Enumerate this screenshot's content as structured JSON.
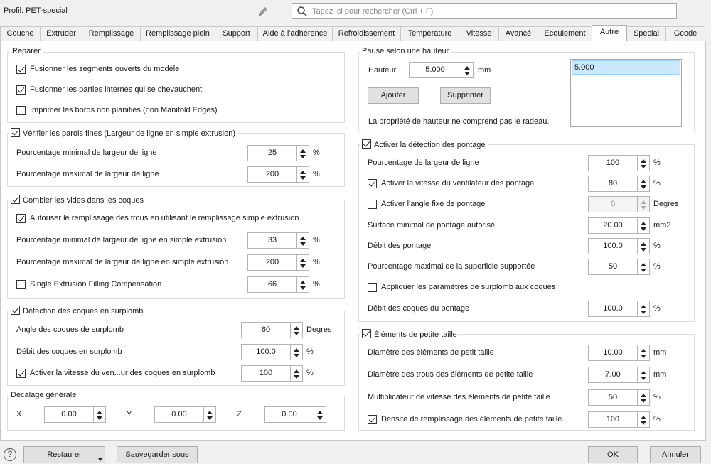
{
  "header": {
    "profile": "Profil: PET-special",
    "search_placeholder": "Tapez ici pour rechercher (Ctrl + F)"
  },
  "tabs": [
    "Couche",
    "Extruder",
    "Remplissage",
    "Remplissage plein",
    "Support",
    "Aide à l'adhérence",
    "Refroidissement",
    "Temperature",
    "Vitesse",
    "Avancé",
    "Ecoulement",
    "Autre",
    "Special",
    "Gcode"
  ],
  "active_tab": "Autre",
  "left": {
    "reparer": {
      "title": "Reparer",
      "items": [
        {
          "label": "Fusionner les segments ouverts du modèle",
          "checked": true
        },
        {
          "label": "Fusionner les parties internes qui se chevauchent",
          "checked": true
        },
        {
          "label": "Imprimer les bords non planifiés (non Manifold Edges)",
          "checked": false
        }
      ]
    },
    "parois": {
      "title": "Vérifier les parois fines (Largeur de ligne en simple extrusion)",
      "checked": true,
      "rows": [
        {
          "label": "Pourcentage minimal de largeur de ligne",
          "value": "25",
          "unit": "%"
        },
        {
          "label": "Pourcentage maximal de largeur de ligne",
          "value": "200",
          "unit": "%"
        }
      ]
    },
    "vides": {
      "title": "Combler les vides dans les coques",
      "checked": true,
      "autoriser": "Autoriser le remplissage des trous en utilisant le remplissage simple extrusion",
      "rows": [
        {
          "label": "Pourcentage minimal de largeur de ligne en simple extrusion",
          "value": "33",
          "unit": "%"
        },
        {
          "label": "Pourcentage maximal de largeur de ligne en simple extrusion",
          "value": "200",
          "unit": "%"
        },
        {
          "label": "Single Extrusion Filling Compensation",
          "value": "66",
          "unit": "%"
        }
      ]
    },
    "surplomb": {
      "title": "Détection des coques en surplomb",
      "checked": true,
      "rows": [
        {
          "label": "Angle des coques de surplomb",
          "value": "60",
          "unit": "Degres"
        },
        {
          "label": "Débit des coques en surplomb",
          "value": "100.0",
          "unit": "%"
        },
        {
          "label": "Activer la vitesse du ven...ur des coques en surplomb",
          "value": "100",
          "unit": "%"
        }
      ]
    },
    "decalage": {
      "title": "Décalage générale",
      "x_label": "X",
      "x": "0.00",
      "y_label": "Y",
      "y": "0.00",
      "z_label": "Z",
      "z": "0.00"
    }
  },
  "right": {
    "pause": {
      "title": "Pause selon une hauteur",
      "hauteur_label": "Hauteur",
      "hauteur": "5.000",
      "unit": "mm",
      "list": [
        "5.000"
      ],
      "add": "Ajouter",
      "remove": "Supprimer",
      "note": "La propriété de hauteur ne comprend pas le radeau."
    },
    "pontage": {
      "title": "Activer la détection des pontage",
      "checked": true,
      "rows": [
        {
          "label": "Pourcentage de largeur de ligne",
          "value": "100",
          "unit": "%"
        },
        {
          "label": "Activer la vitesse du ventilateur des pontage",
          "value": "80",
          "unit": "%",
          "checked": true
        },
        {
          "label": "Activer l'angle fixe de pontage",
          "value": "0",
          "unit": "Degres",
          "checked": false
        },
        {
          "label": "Surface minimal de pontage autorisé",
          "value": "20.00",
          "unit": "mm2"
        },
        {
          "label": "Débit des pontage",
          "value": "100.0",
          "unit": "%"
        },
        {
          "label": "Pourcentage maximal de la superficie supportée",
          "value": "50",
          "unit": "%"
        }
      ],
      "appliquer": "Appliquer les paramètres de surplomb aux coques",
      "debit_coques": {
        "label": "Débit des coques du pontage",
        "value": "100.0",
        "unit": "%"
      }
    },
    "petits": {
      "title": "Éléments de petite taille",
      "checked": true,
      "rows": [
        {
          "label": "Diamètre des éléments de petit taille",
          "value": "10.00",
          "unit": "mm"
        },
        {
          "label": "Diamètre des trous des éléments de petite taille",
          "value": "7.00",
          "unit": "mm"
        },
        {
          "label": "Multiplicateur de vitesse des éléments de petite taille",
          "value": "50",
          "unit": "%"
        },
        {
          "label": "Densité de remplissage des éléments de petite taille",
          "value": "100",
          "unit": "%",
          "checked": true
        }
      ]
    }
  },
  "footer": {
    "help": "?",
    "restaurer": "Restaurer",
    "sauvegarder": "Sauvegarder sous",
    "ok": "OK",
    "annuler": "Annuler"
  }
}
